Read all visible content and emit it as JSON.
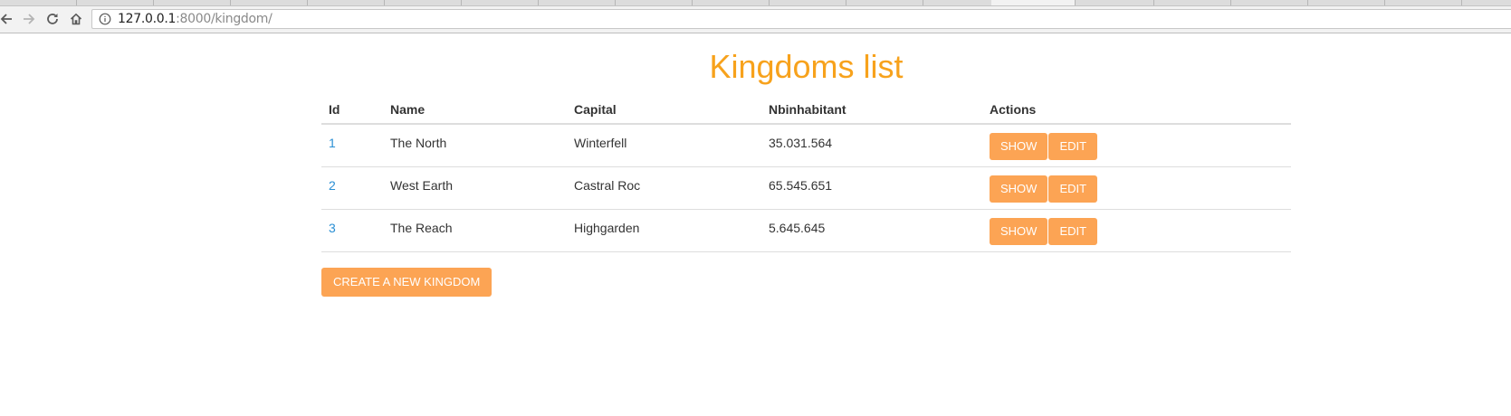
{
  "browser": {
    "url_host": "127.0.0.1",
    "url_path": ":8000/kingdom/"
  },
  "page": {
    "title": "Kingdoms list"
  },
  "table": {
    "headers": [
      "Id",
      "Name",
      "Capital",
      "Nbinhabitant",
      "Actions"
    ],
    "rows": [
      {
        "id": "1",
        "name": "The North",
        "capital": "Winterfell",
        "nbinhabitant": "35.031.564",
        "show_label": "SHOW",
        "edit_label": "EDIT"
      },
      {
        "id": "2",
        "name": "West Earth",
        "capital": "Castral Roc",
        "nbinhabitant": "65.545.651",
        "show_label": "SHOW",
        "edit_label": "EDIT"
      },
      {
        "id": "3",
        "name": "The Reach",
        "capital": "Highgarden",
        "nbinhabitant": "5.645.645",
        "show_label": "SHOW",
        "edit_label": "EDIT"
      }
    ]
  },
  "actions": {
    "create_label": "CREATE A NEW KINGDOM"
  },
  "colors": {
    "title": "#f7a21c",
    "button": "#fca454",
    "link": "#2a8fd4"
  }
}
